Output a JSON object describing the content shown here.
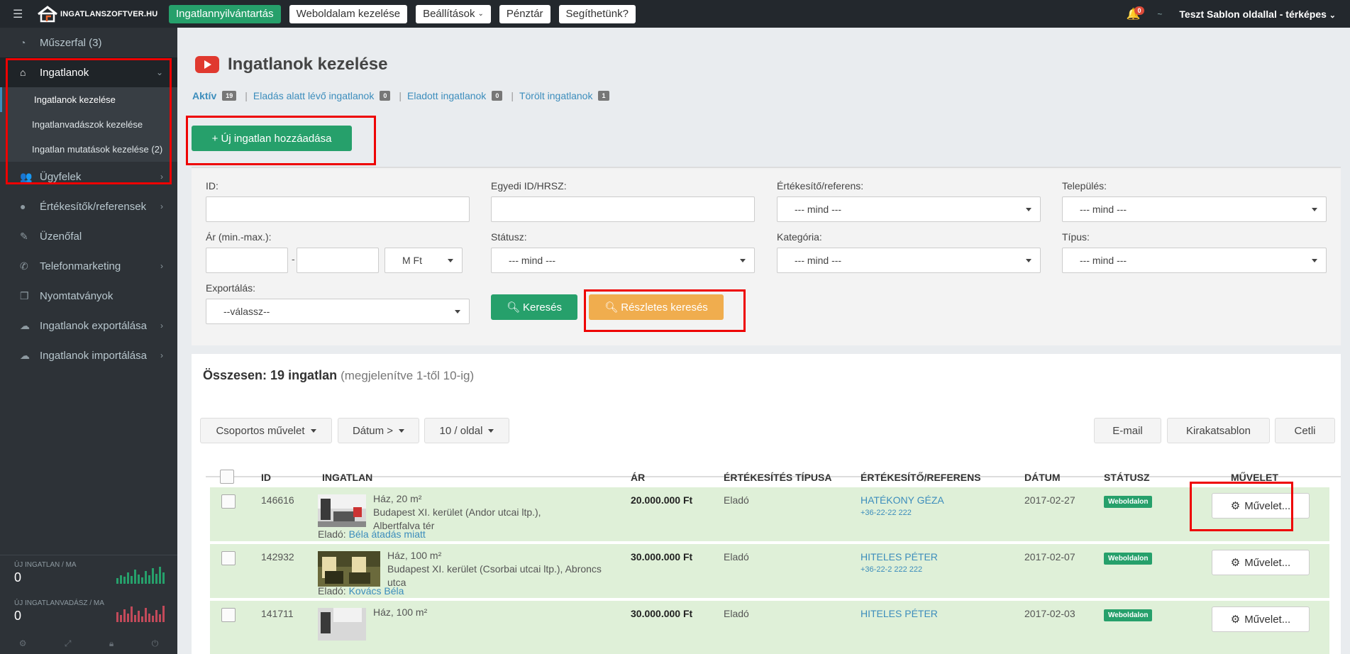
{
  "topbar": {
    "logo_text": "INGATLANSZOFTVER.HU",
    "nav": [
      "Ingatlannyilvántartás",
      "Weboldalam kezelése",
      "Beállítások",
      "Pénztár",
      "Segíthetünk?"
    ],
    "notification_count": "0",
    "user": "Teszt Sablon oldallal - térképes"
  },
  "sidebar": {
    "items": [
      {
        "label": "Műszerfal (3)",
        "icon": "dashboard-icon"
      },
      {
        "label": "Ingatlanok",
        "icon": "home-icon"
      },
      {
        "label": "Ügyfelek",
        "icon": "users-icon"
      },
      {
        "label": "Értékesítők/referensek",
        "icon": "user-icon"
      },
      {
        "label": "Üzenőfal",
        "icon": "edit-icon"
      },
      {
        "label": "Telefonmarketing",
        "icon": "phone-icon"
      },
      {
        "label": "Nyomtatványok",
        "icon": "copy-icon"
      },
      {
        "label": "Ingatlanok exportálása",
        "icon": "cloud-upload-icon"
      },
      {
        "label": "Ingatlanok importálása",
        "icon": "cloud-download-icon"
      }
    ],
    "submenu": [
      "Ingatlanok kezelése",
      "Ingatlanvadászok kezelése",
      "Ingatlan mutatások kezelése (2)"
    ],
    "stats": [
      {
        "label": "ÚJ INGATLAN / MA",
        "value": "0"
      },
      {
        "label": "ÚJ INGATLANVADÁSZ / MA",
        "value": "0"
      }
    ]
  },
  "page": {
    "title": "Ingatlanok kezelése",
    "tabs": [
      {
        "label": "Aktív",
        "count": "19"
      },
      {
        "label": "Eladás alatt lévő ingatlanok",
        "count": "0"
      },
      {
        "label": "Eladott ingatlanok",
        "count": "0"
      },
      {
        "label": "Törölt ingatlanok",
        "count": "1"
      }
    ],
    "add_button": "+ Új ingatlan hozzáadása"
  },
  "filters": {
    "id_label": "ID:",
    "egyedi_label": "Egyedi ID/HRSZ:",
    "ertekesito_label": "Értékesítő/referens:",
    "telepules_label": "Település:",
    "ar_label": "Ár (min.-max.):",
    "statusz_label": "Státusz:",
    "kategoria_label": "Kategória:",
    "tipus_label": "Típus:",
    "export_label": "Exportálás:",
    "mind": "--- mind ---",
    "currency": "M Ft",
    "export_value": "--válassz--",
    "search_button": "Keresés",
    "detail_button": "Részletes keresés"
  },
  "list": {
    "summary_bold": "Összesen: 19 ingatlan",
    "summary_muted": "(megjelenítve 1-től 10-ig)",
    "group_action": "Csoportos művelet",
    "sort": "Dátum >",
    "per_page": "10 / oldal",
    "email": "E-mail",
    "kirakat": "Kirakatsablon",
    "cetli": "Cetli",
    "columns": [
      "ID",
      "INGATLAN",
      "ÁR",
      "ÉRTÉKESÍTÉS TÍPUSA",
      "ÉRTÉKESÍTŐ/REFERENS",
      "DÁTUM",
      "STÁTUSZ",
      "MŰVELET"
    ],
    "rows": [
      {
        "id": "146616",
        "type": "Ház, 20 m²",
        "loc1": "Budapest XI. kerület (Andor utcai ltp.),",
        "loc2": "Albertfalva tér",
        "seller_prefix": "Eladó:",
        "seller": "Béla átadás miatt",
        "price": "20.000.000 Ft",
        "sale": "Eladó",
        "agent": "HATÉKONY GÉZA",
        "phone": "+36-22-22 222",
        "date": "2017-02-27",
        "status": "Weboldalon",
        "action": "Művelet..."
      },
      {
        "id": "142932",
        "type": "Ház, 100 m²",
        "loc1": "Budapest XI. kerület (Csorbai utcai ltp.), Abroncs",
        "loc2": "utca",
        "seller_prefix": "Eladó:",
        "seller": "Kovács Béla",
        "price": "30.000.000 Ft",
        "sale": "Eladó",
        "agent": "HITELES PÉTER",
        "phone": "+36-22-2 222 222",
        "date": "2017-02-07",
        "status": "Weboldalon",
        "action": "Művelet..."
      },
      {
        "id": "141711",
        "type": "Ház, 100 m²",
        "price": "30.000.000 Ft",
        "sale": "Eladó",
        "agent": "HITELES PÉTER",
        "date": "2017-02-03",
        "status": "Weboldalon",
        "action": "Művelet..."
      }
    ]
  }
}
